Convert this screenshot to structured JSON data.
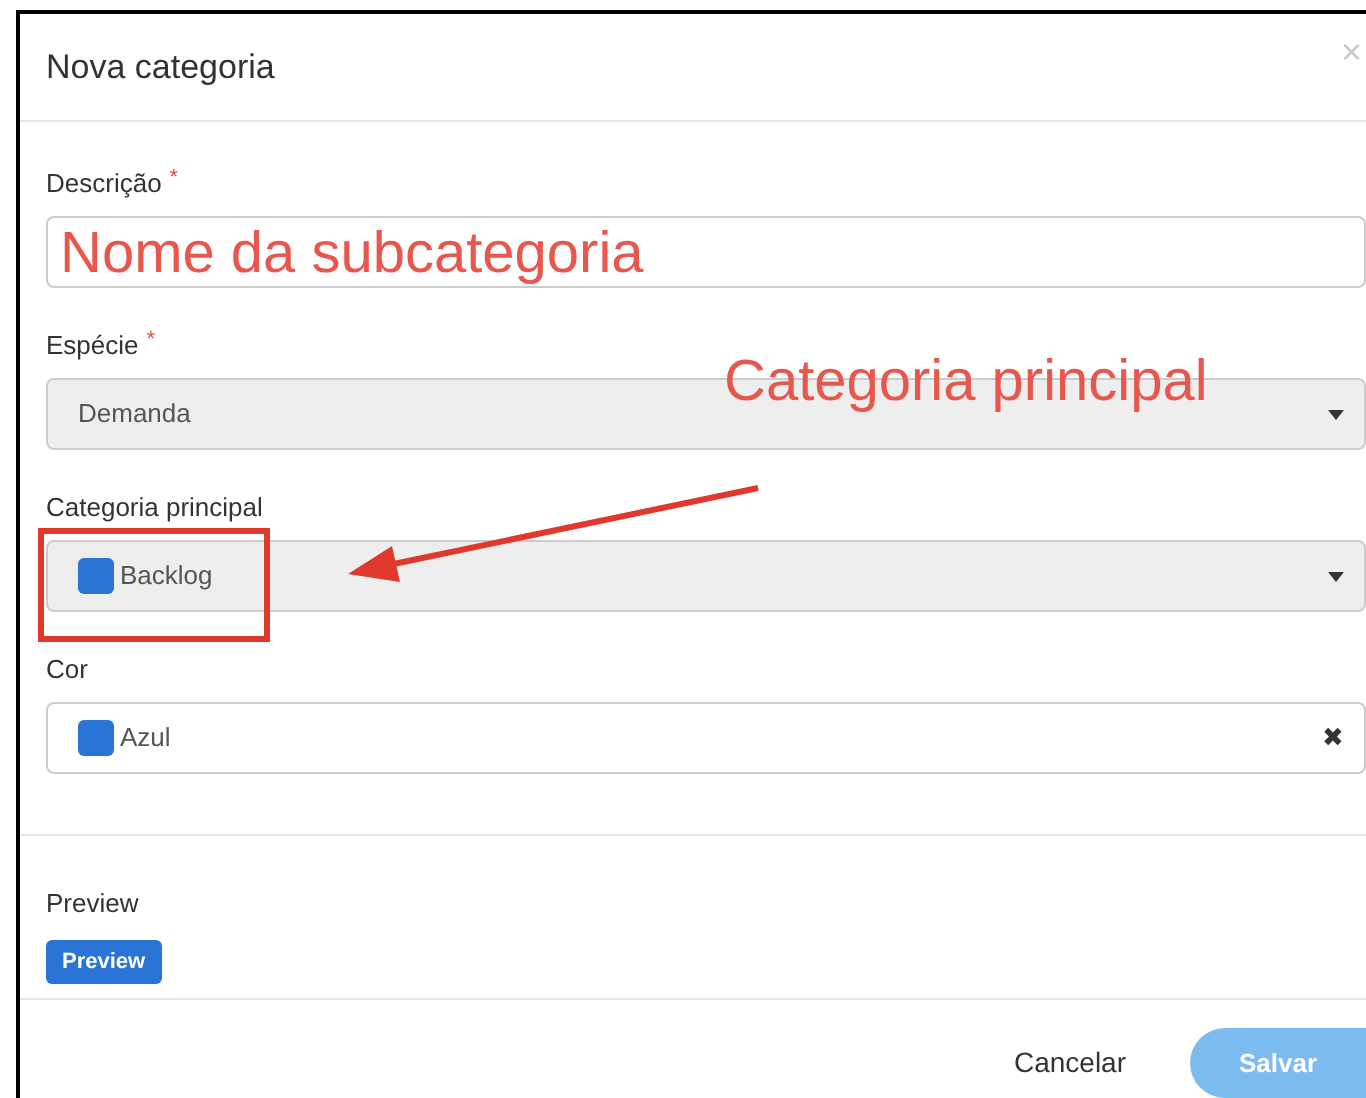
{
  "dialog": {
    "title": "Nova categoria",
    "close": "×"
  },
  "fields": [
    {
      "label": "Descrição",
      "required_mark": "*",
      "kind": "text",
      "disabled": false
    },
    {
      "label": "Espécie",
      "required_mark": "*",
      "kind": "select",
      "disabled": true,
      "value": "Demanda"
    },
    {
      "label": "Categoria principal",
      "kind": "select",
      "disabled": true,
      "value": "Backlog",
      "color": "#2a74d6"
    },
    {
      "label": "Cor",
      "kind": "clearable",
      "disabled": false,
      "value": "Azul",
      "color": "#2a74d6",
      "clear": "✖"
    }
  ],
  "preview": {
    "label": "Preview",
    "badge": "Preview"
  },
  "buttons": [
    {
      "label": "Cancelar",
      "kind": "link"
    },
    {
      "label": "Salvar",
      "kind": "primary",
      "disabled": true
    }
  ],
  "annotations": {
    "field_note": "Nome da subcategoria",
    "callout": "Categoria principal"
  }
}
